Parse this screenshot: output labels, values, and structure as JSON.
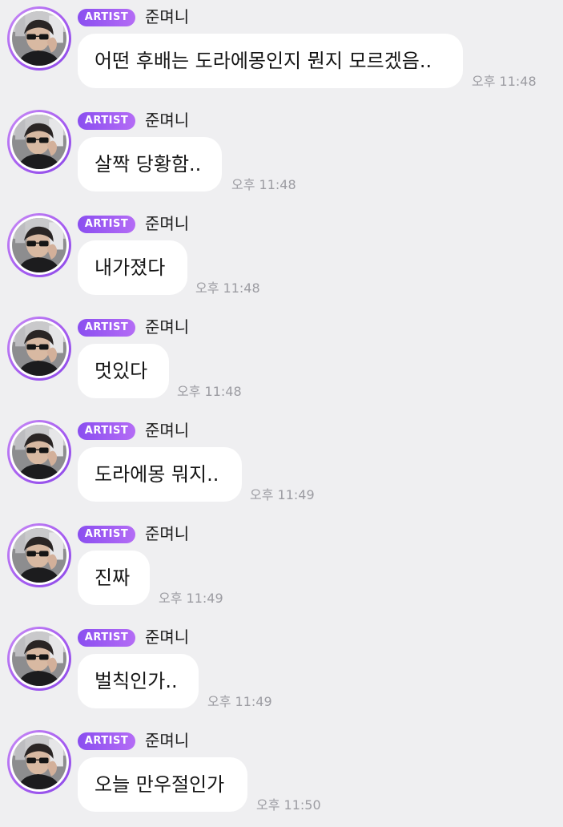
{
  "chat": {
    "messages": [
      {
        "badge": "ARTIST",
        "sender": "준며니",
        "text": "어떤 후배는 도라에몽인지 뭔지 모르겠음..",
        "time": "오후 11:48"
      },
      {
        "badge": "ARTIST",
        "sender": "준며니",
        "text": "살짝 당황함..",
        "time": "오후 11:48"
      },
      {
        "badge": "ARTIST",
        "sender": "준며니",
        "text": "내가졌다",
        "time": "오후 11:48"
      },
      {
        "badge": "ARTIST",
        "sender": "준며니",
        "text": "멋있다",
        "time": "오후 11:48"
      },
      {
        "badge": "ARTIST",
        "sender": "준며니",
        "text": "도라에몽 뭐지..",
        "time": "오후 11:49"
      },
      {
        "badge": "ARTIST",
        "sender": "준며니",
        "text": "진짜",
        "time": "오후 11:49"
      },
      {
        "badge": "ARTIST",
        "sender": "준며니",
        "text": "벌칙인가..",
        "time": "오후 11:49"
      },
      {
        "badge": "ARTIST",
        "sender": "준며니",
        "text": "오늘 만우절인가",
        "time": "오후 11:50"
      }
    ]
  },
  "colors": {
    "background": "#efeff1",
    "bubble": "#ffffff",
    "badge_start": "#8a4ef0",
    "badge_end": "#b46cf5",
    "avatar_ring": "#a55cf0",
    "timestamp": "#9c9ca2"
  }
}
